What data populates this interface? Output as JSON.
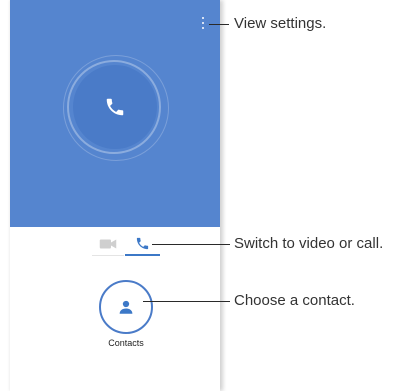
{
  "callouts": {
    "settings": "View settings.",
    "switch": "Switch to video or call.",
    "contact": "Choose a contact."
  },
  "contacts": {
    "label": "Contacts"
  },
  "icons": {
    "overflow": "more-vert-icon",
    "call": "phone-icon",
    "video": "videocam-icon",
    "contact": "person-icon"
  },
  "colors": {
    "hero": "#5585cf",
    "accent": "#3c78c7",
    "video_inactive": "#cfcfcf"
  }
}
